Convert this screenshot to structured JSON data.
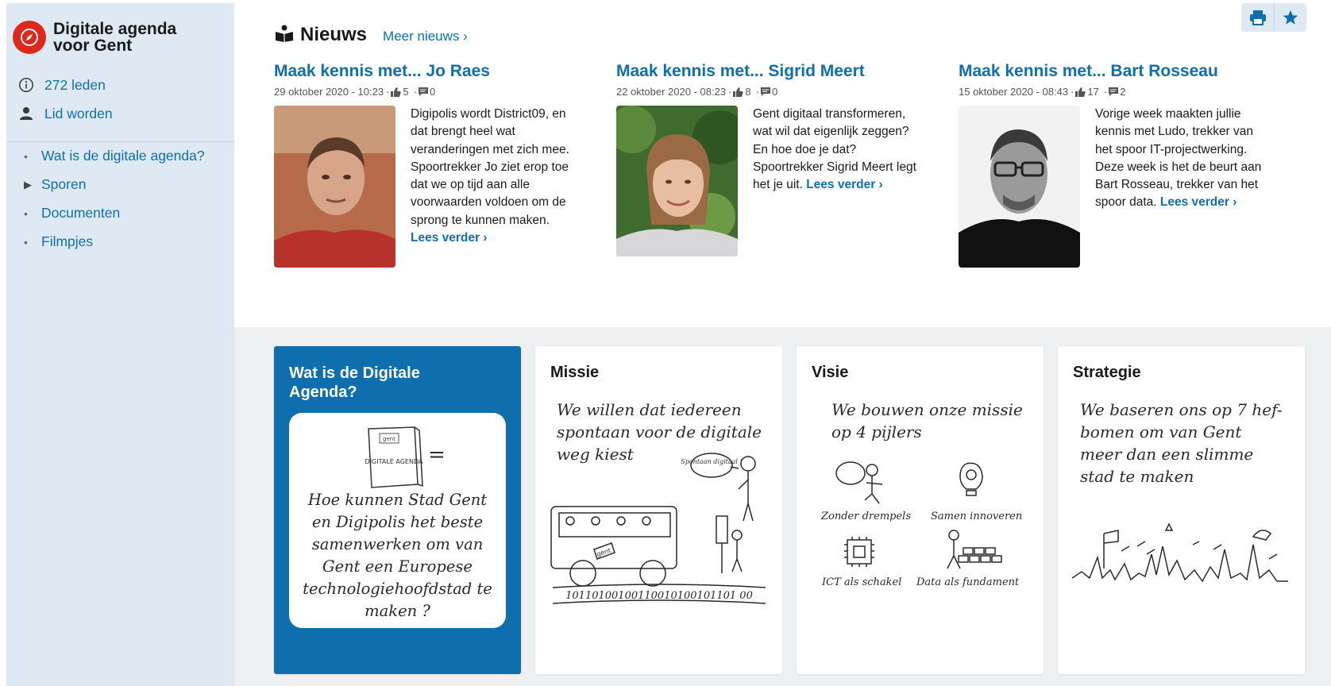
{
  "sidebar": {
    "brand_title": "Digitale agenda voor Gent",
    "members": "272 leden",
    "join": "Lid worden",
    "nav": [
      "Wat is de digitale agenda?",
      "Sporen",
      "Documenten",
      "Filmpjes"
    ]
  },
  "news": {
    "title": "Nieuws",
    "more": "Meer nieuws ›",
    "articles": [
      {
        "title": "Maak kennis met... Jo Raes",
        "date": "29 oktober 2020 - 10:23",
        "likes": "5",
        "comments": "0",
        "excerpt": "Digipolis wordt District09, en dat brengt heel wat veranderingen met zich mee. Spoortrekker Jo ziet erop toe dat we op tijd aan alle voorwaarden voldoen om de sprong te kunnen maken.",
        "read_more": "Lees verder ›"
      },
      {
        "title": "Maak kennis met... Sigrid Meert",
        "date": "22 oktober 2020 - 08:23",
        "likes": "8",
        "comments": "0",
        "excerpt": "Gent digitaal transformeren, wat wil dat eigenlijk zeggen? En hoe doe je dat? Spoortrekker Sigrid Meert legt het je uit.",
        "read_more": "Lees verder ›"
      },
      {
        "title": "Maak kennis met... Bart Rosseau",
        "date": "15 oktober 2020 - 08:43",
        "likes": "17",
        "comments": "2",
        "excerpt": "Vorige week maakten jullie kennis met Ludo, trekker van het spoor IT-projectwerking. Deze week is het de beurt aan Bart Rosseau, trekker van het spoor data.",
        "read_more": "Lees verder ›"
      }
    ]
  },
  "cards": [
    {
      "title": "Wat is de Digitale Agenda?",
      "book_label": "DIGITALE AGENDA",
      "book_tag": "gent",
      "equals": "=",
      "text": "Hoe kunnen Stad Gent en Digipolis het beste samenwerken om van Gent een Europese technologiehoofdstad te maken ?"
    },
    {
      "title": "Missie",
      "text": "We willen dat iedereen spontaan voor de digitale weg kiest",
      "speech": "Spontaan digitaal !",
      "bus_tag": "gent",
      "binary": "10110100100110010100101101 00"
    },
    {
      "title": "Visie",
      "text": "We bouwen onze missie op 4 pijlers",
      "pillars": [
        "Zonder drempels",
        "Samen innoveren",
        "ICT als schakel",
        "Data als fundament"
      ]
    },
    {
      "title": "Strategie",
      "text": "We baseren ons op 7 hef-bomen om van Gent meer dan een slimme stad te maken"
    }
  ],
  "colors": {
    "accent": "#0f6fae",
    "brand_red": "#e1261c",
    "sidebar_bg": "#dfe9f3"
  },
  "icons": {
    "print": "printer-icon",
    "favorite": "star-icon"
  }
}
